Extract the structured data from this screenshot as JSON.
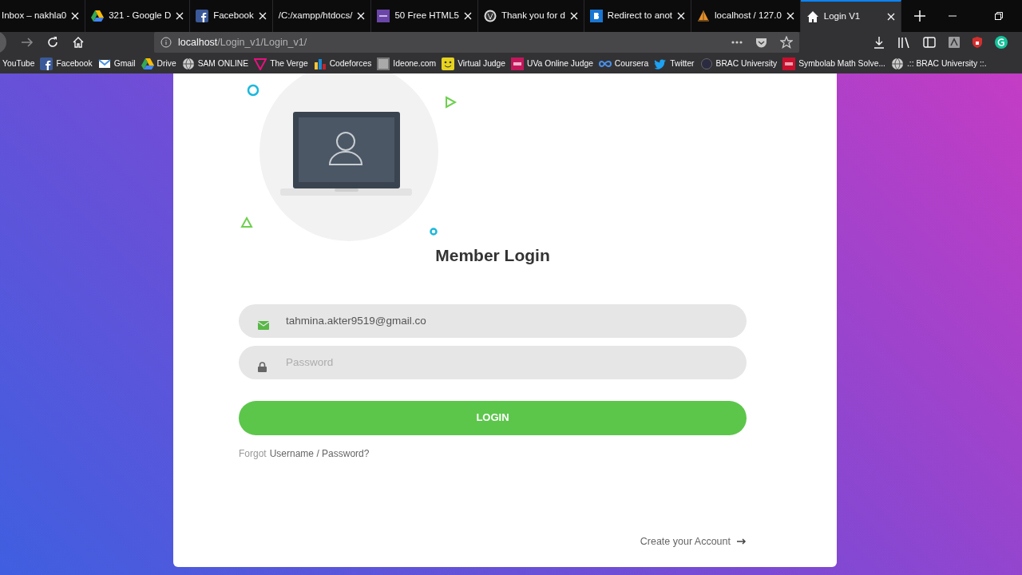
{
  "tabs": [
    {
      "title": "Inbox – nakhla0",
      "kind": "none",
      "selected": false
    },
    {
      "title": "321 - Google D",
      "kind": "drive",
      "selected": false
    },
    {
      "title": "Facebook",
      "kind": "facebook",
      "selected": false
    },
    {
      "title": "/C:/xampp/htdocs/",
      "kind": "none",
      "selected": false
    },
    {
      "title": "50 Free HTML5",
      "kind": "purple",
      "selected": false
    },
    {
      "title": "Thank you for d",
      "kind": "wordpress",
      "selected": false
    },
    {
      "title": "Redirect to anot",
      "kind": "blue-b",
      "selected": false
    },
    {
      "title": "localhost / 127.0",
      "kind": "sail",
      "selected": false
    },
    {
      "title": "Login V1",
      "kind": "home",
      "selected": true
    }
  ],
  "address": {
    "host": "localhost",
    "path": "/Login_v1/Login_v1/"
  },
  "bookmarks": [
    {
      "label": "YouTube",
      "kind": "none"
    },
    {
      "label": "Facebook",
      "kind": "facebook"
    },
    {
      "label": "Gmail",
      "kind": "mail"
    },
    {
      "label": "Drive",
      "kind": "drive"
    },
    {
      "label": "SAM ONLINE",
      "kind": "globe"
    },
    {
      "label": "The Verge",
      "kind": "verge"
    },
    {
      "label": "Codeforces",
      "kind": "bars"
    },
    {
      "label": "Ideone.com",
      "kind": "grey"
    },
    {
      "label": "Virtual Judge",
      "kind": "smile"
    },
    {
      "label": "UVa Online Judge",
      "kind": "uva"
    },
    {
      "label": "Coursera",
      "kind": "coursera"
    },
    {
      "label": "Twitter",
      "kind": "twitter"
    },
    {
      "label": "BRAC University",
      "kind": "seal"
    },
    {
      "label": "Symbolab Math Solve...",
      "kind": "sy"
    },
    {
      "label": ".:: BRAC University ::.",
      "kind": "globe"
    }
  ],
  "login": {
    "title": "Member Login",
    "email": {
      "value": "tahmina.akter9519@gmail.co"
    },
    "password": {
      "placeholder": "Password"
    },
    "button": "LOGIN",
    "forgot_prefix": "Forgot",
    "forgot_link": "Username / Password?",
    "create_account": "Create your Account"
  }
}
